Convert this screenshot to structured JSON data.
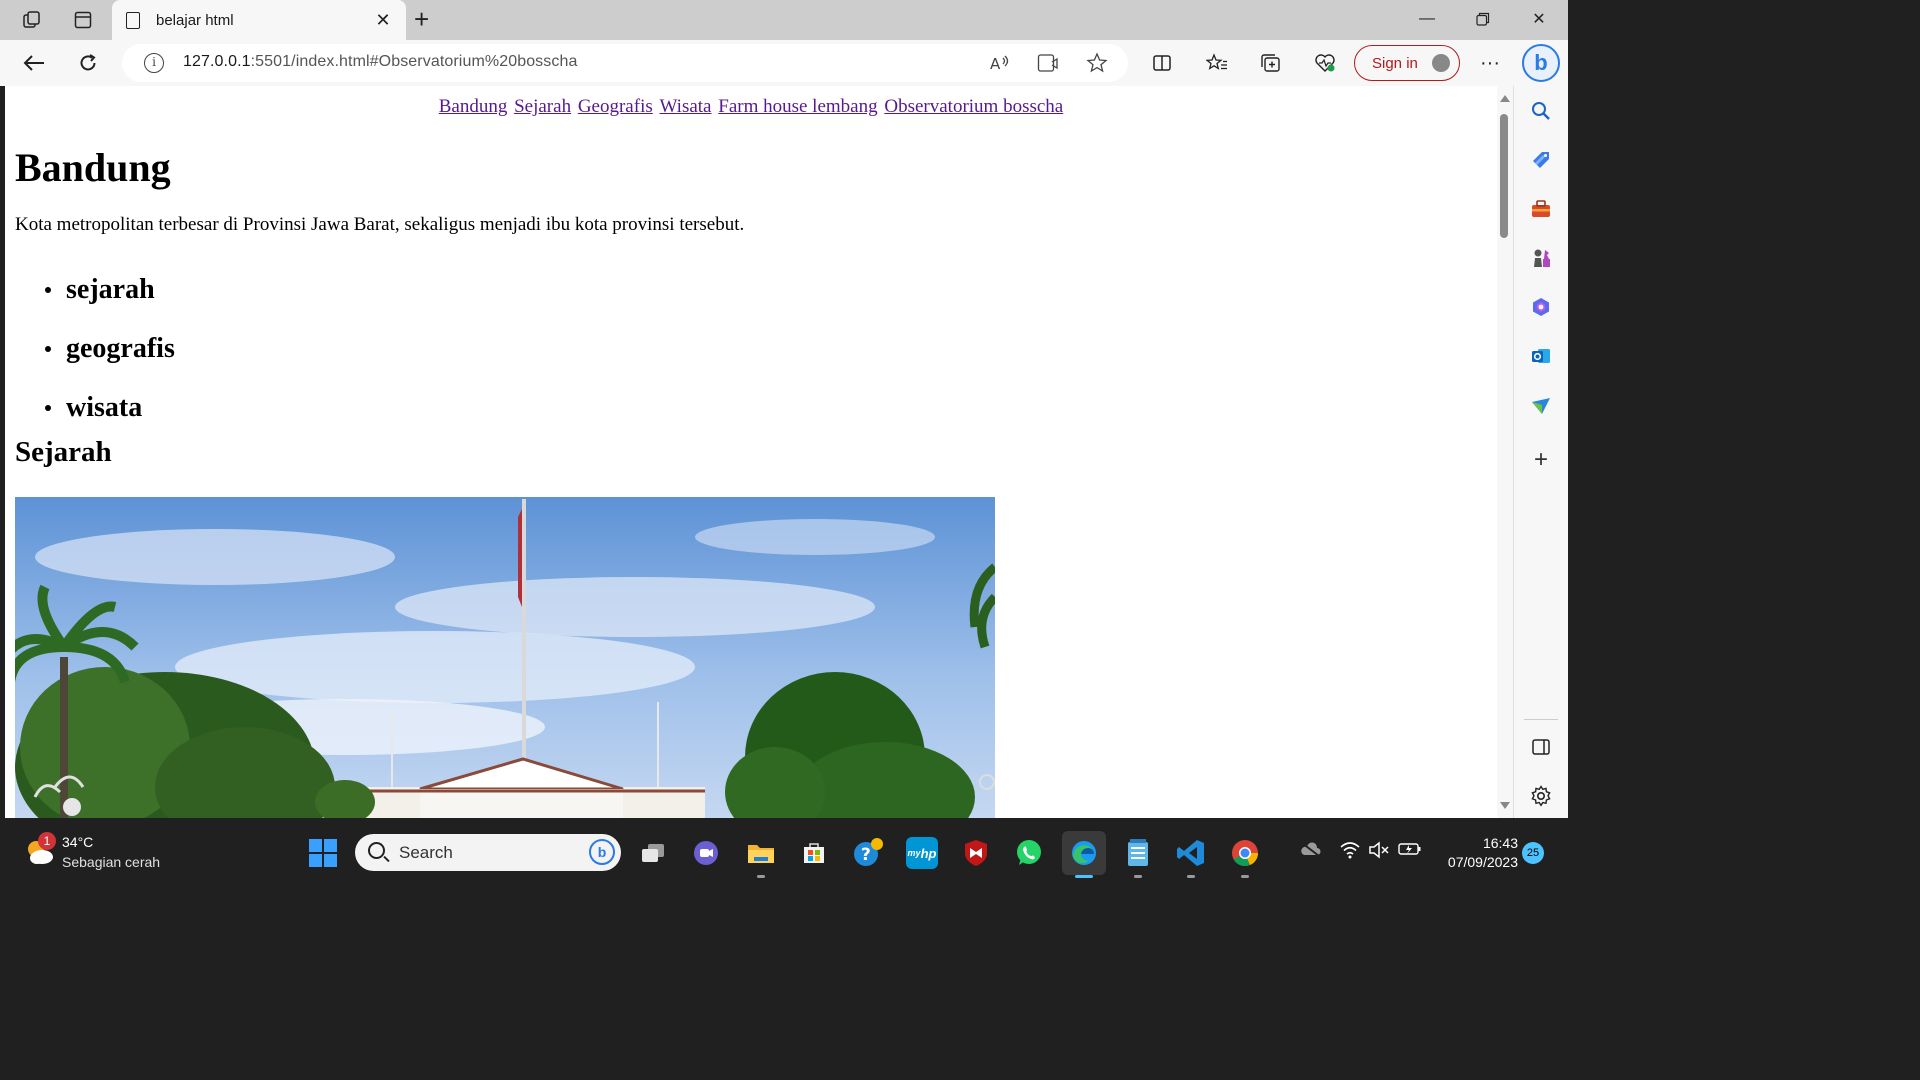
{
  "browser": {
    "tab_title": "belajar html",
    "url_host": "127.0.0.1",
    "url_rest": ":5501/index.html#Observatorium%20bosscha",
    "signin_label": "Sign in"
  },
  "page": {
    "nav_links": [
      "Bandung",
      "Sejarah",
      "Geografis",
      "Wisata",
      "Farm house lembang",
      "Observatorium bosscha"
    ],
    "heading": "Bandung",
    "lead": "Kota metropolitan terbesar di Provinsi Jawa Barat, sekaligus menjadi ibu kota provinsi tersebut.",
    "bullets": [
      "sejarah",
      "geografis",
      "wisata"
    ],
    "section_heading": "Sejarah"
  },
  "taskbar": {
    "weather_temp": "34°C",
    "weather_desc": "Sebagian cerah",
    "weather_badge": "1",
    "search_placeholder": "Search",
    "time": "16:43",
    "date": "07/09/2023",
    "notification_count": "25",
    "hp_label": "hp"
  },
  "icons": {
    "sidebar": [
      "search-icon",
      "tag-icon",
      "toolbox-icon",
      "chess-icon",
      "copilot-icon",
      "outlook-icon",
      "send-icon",
      "add-icon",
      "split-icon",
      "settings-icon"
    ]
  }
}
